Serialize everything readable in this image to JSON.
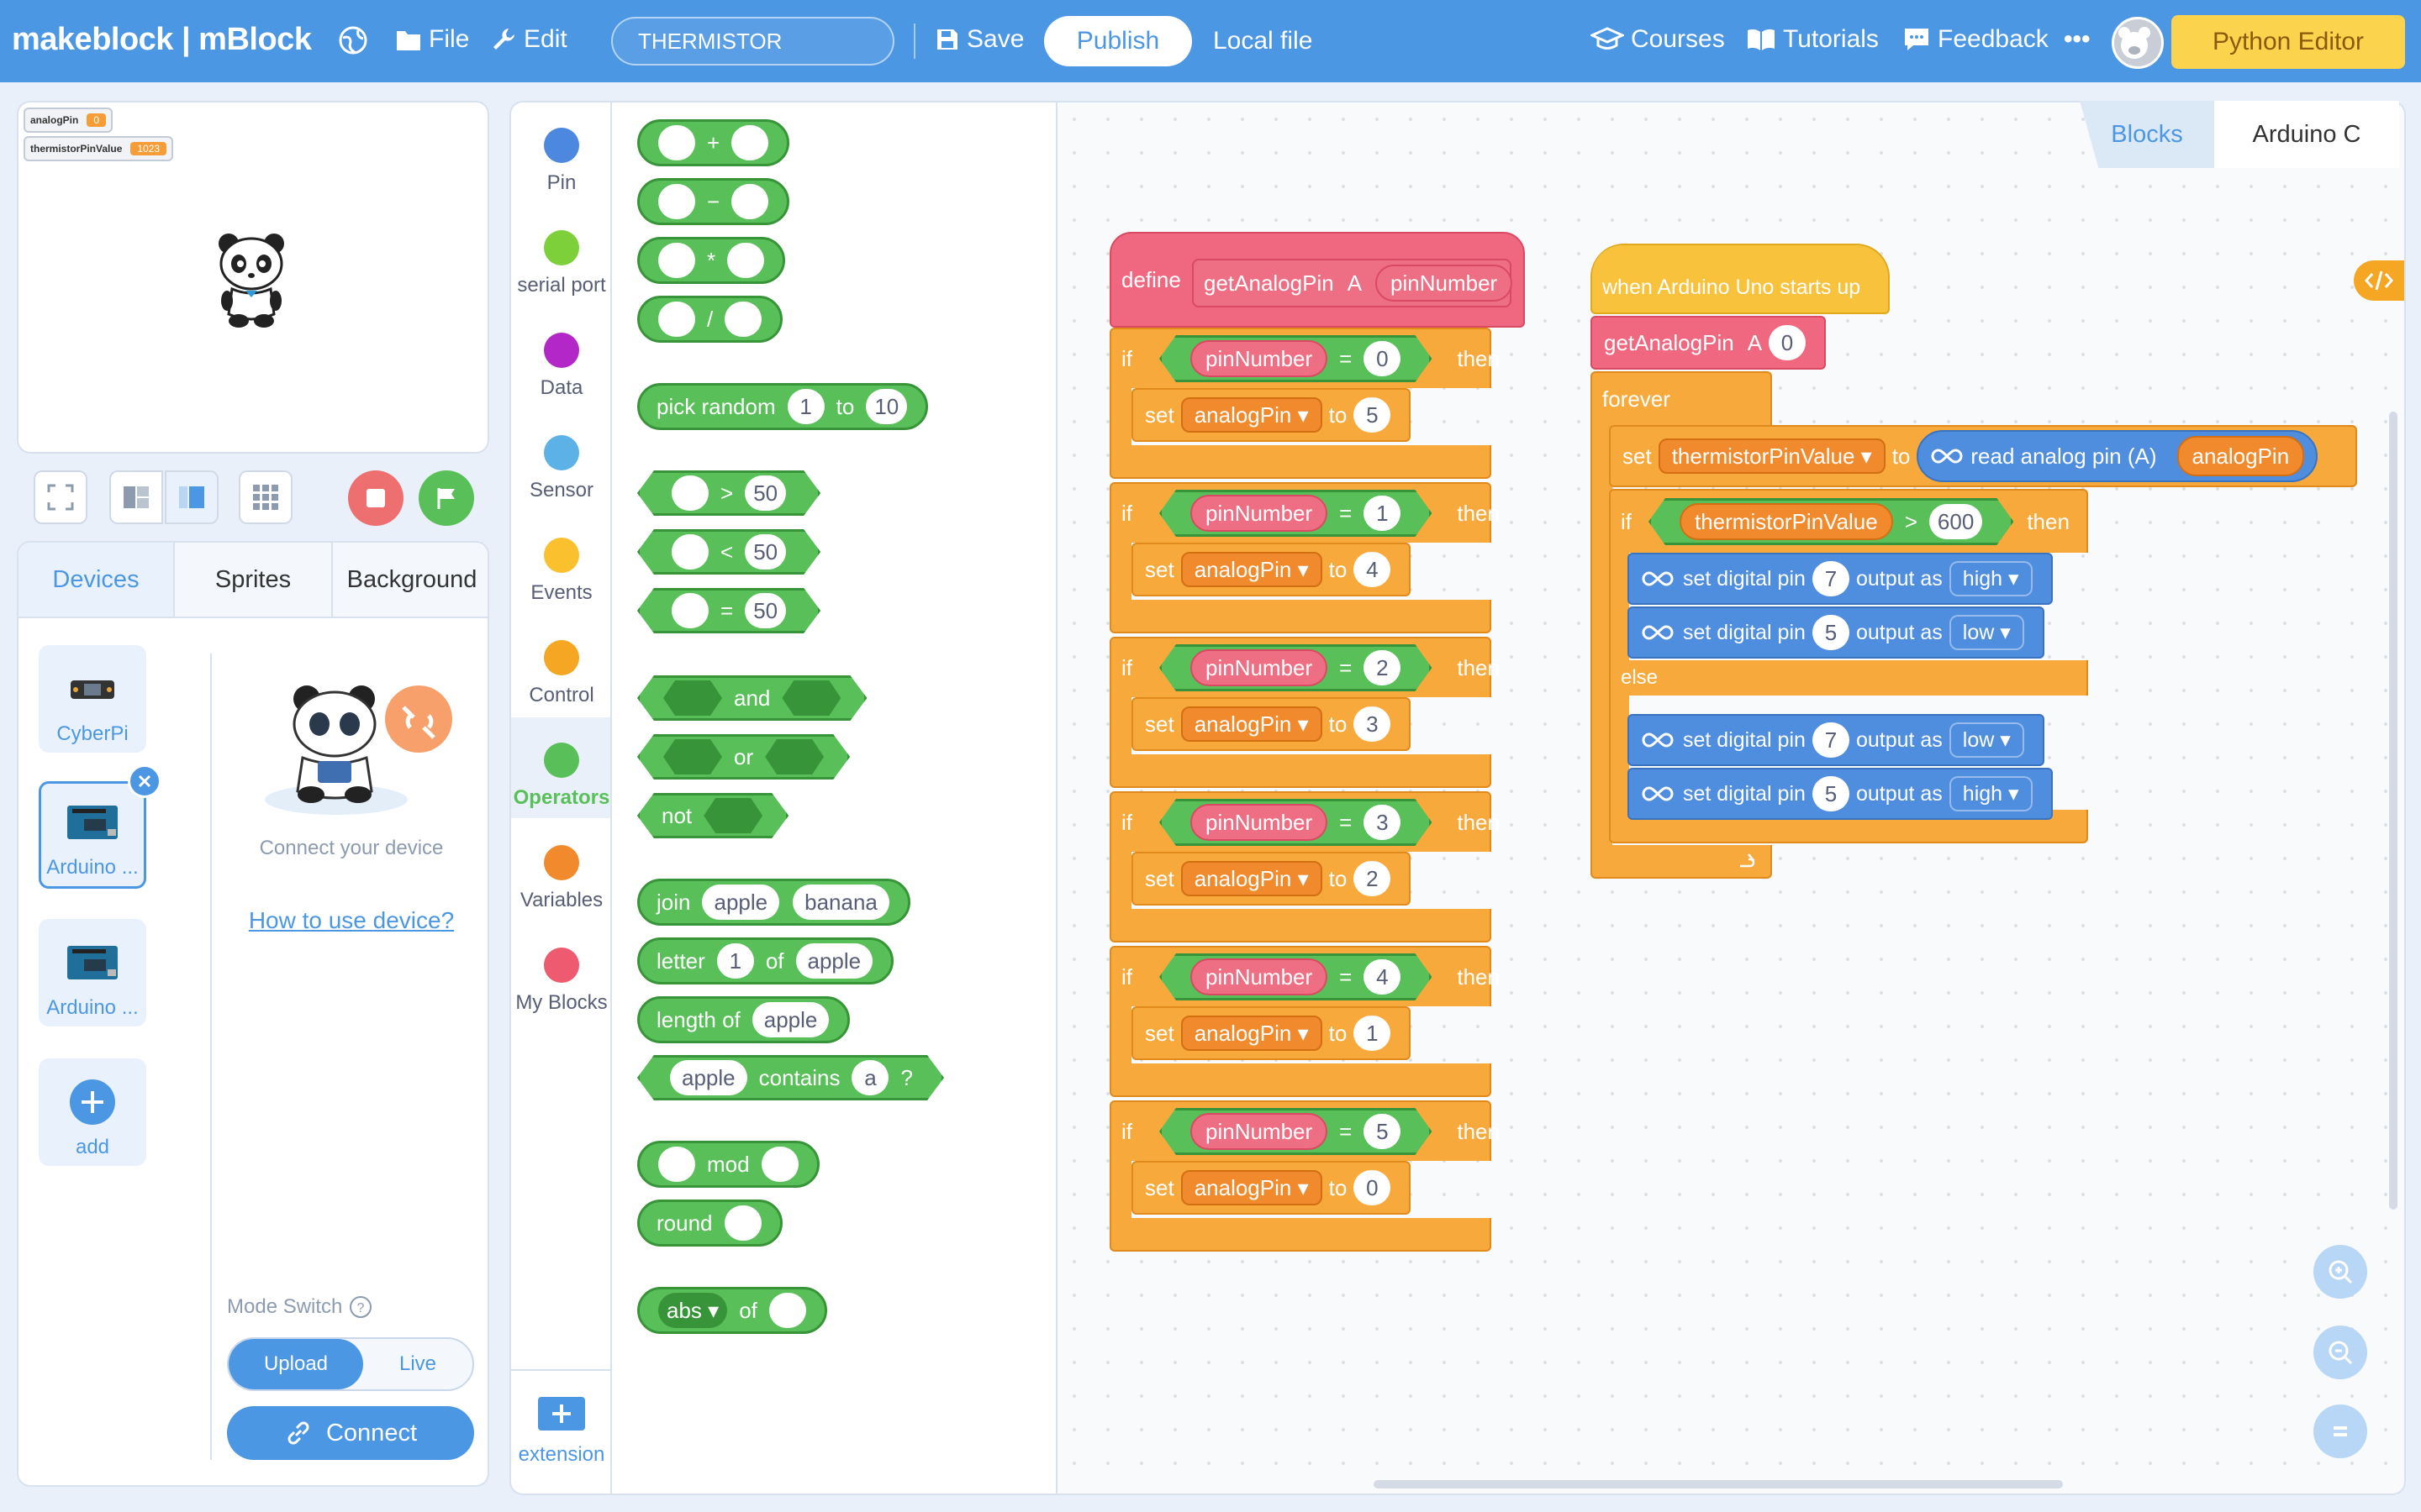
{
  "header": {
    "brand": "makeblock | mBlock",
    "file": "File",
    "edit": "Edit",
    "project_name": "THERMISTOR",
    "save": "Save",
    "publish": "Publish",
    "local_file": "Local file",
    "courses": "Courses",
    "tutorials": "Tutorials",
    "feedback": "Feedback",
    "more": "•••",
    "python_editor": "Python Editor"
  },
  "stage": {
    "monitors": [
      {
        "name": "analogPin",
        "value": "0"
      },
      {
        "name": "thermistorPinValue",
        "value": "1023"
      }
    ]
  },
  "device_panel": {
    "tabs": [
      "Devices",
      "Sprites",
      "Background"
    ],
    "devices": [
      "CyberPi",
      "Arduino ...",
      "Arduino ...",
      "add"
    ],
    "connect_text": "Connect your device",
    "how_to": "How to use device?",
    "mode_switch": "Mode Switch",
    "upload": "Upload",
    "live": "Live",
    "connect_button": "Connect"
  },
  "categories": [
    {
      "label": "Pin",
      "color": "#4c88e0"
    },
    {
      "label": "serial port",
      "color": "#7ed03a"
    },
    {
      "label": "Data",
      "color": "#b327c8"
    },
    {
      "label": "Sensor",
      "color": "#5cb1e6"
    },
    {
      "label": "Events",
      "color": "#fbc02d"
    },
    {
      "label": "Control",
      "color": "#f5a623"
    },
    {
      "label": "Operators",
      "color": "#59c059"
    },
    {
      "label": "Variables",
      "color": "#f08a2c"
    },
    {
      "label": "My Blocks",
      "color": "#ee5a6f"
    }
  ],
  "extension": "extension",
  "palette": {
    "plus": "+",
    "minus": "−",
    "times": "*",
    "divide": "/",
    "pick_random": "pick random",
    "to": "to",
    "rand_a": "1",
    "rand_b": "10",
    "gt": ">",
    "lt": "<",
    "eq": "=",
    "fifty": "50",
    "and": "and",
    "or": "or",
    "not": "not",
    "join": "join",
    "apple": "apple",
    "banana": "banana",
    "letter": "letter",
    "of": "of",
    "one": "1",
    "length_of": "length of",
    "contains": "contains",
    "a": "a",
    "q": "?",
    "mod": "mod",
    "round": "round",
    "abs": "abs ▾"
  },
  "workspace": {
    "tabs": [
      "Blocks",
      "Arduino C"
    ],
    "define": {
      "define": "define",
      "name": "getAnalogPin",
      "letter": "A",
      "param": "pinNumber"
    },
    "if_blocks": [
      {
        "n": "0",
        "v": "5"
      },
      {
        "n": "1",
        "v": "4"
      },
      {
        "n": "2",
        "v": "3"
      },
      {
        "n": "3",
        "v": "2"
      },
      {
        "n": "4",
        "v": "1"
      },
      {
        "n": "5",
        "v": "0"
      }
    ],
    "kw_if": "if",
    "kw_then": "then",
    "kw_set": "set",
    "kw_to": "to",
    "kw_eq": "=",
    "var_analog": "analogPin ▾",
    "param_pill": "pinNumber",
    "main": {
      "hat": "when Arduino Uno starts up",
      "call": "getAnalogPin",
      "call_letter": "A",
      "call_arg": "0",
      "forever": "forever",
      "set": "set",
      "var": "thermistorPinValue ▾",
      "to": "to",
      "read": "read analog pin  (A)",
      "read_arg": "analogPin",
      "if": "if",
      "cmp_var": "thermistorPinValue",
      "gt": ">",
      "threshold": "600",
      "then": "then",
      "else": "else",
      "digital": "set digital pin",
      "output_as": "output as",
      "writes": [
        {
          "pin": "7",
          "level": "high ▾"
        },
        {
          "pin": "5",
          "level": "low ▾"
        },
        {
          "pin": "7",
          "level": "low ▾"
        },
        {
          "pin": "5",
          "level": "high ▾"
        }
      ]
    }
  }
}
